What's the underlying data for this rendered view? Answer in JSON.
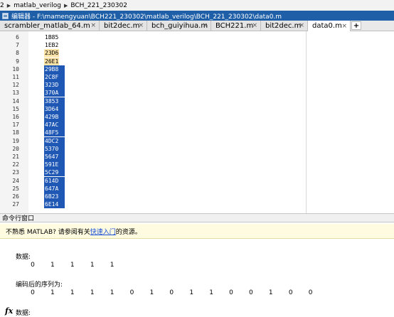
{
  "breadcrumb": {
    "pre": "2",
    "items": [
      "matlab_verilog",
      "BCH_221_230302"
    ]
  },
  "editor_title": "编辑器 - F:\\mamengyuan\\BCH221_230302\\matlab_verilog\\BCH_221_230302\\data0.m",
  "tabs": [
    {
      "label": "scrambler_matlab_64.m",
      "close": "×"
    },
    {
      "label": "bit2dec.m",
      "close": "×"
    },
    {
      "label": "bch_guiyihua.m",
      "close": "×"
    },
    {
      "label": "BCH221.m",
      "close": "×"
    },
    {
      "label": "bit2dec.m",
      "close": "×"
    },
    {
      "label": "data0.m",
      "close": "×",
      "active": true
    }
  ],
  "add_tab": "+",
  "code_lines": [
    {
      "n": "6",
      "t": "1B85",
      "s": "normal"
    },
    {
      "n": "7",
      "t": "1EB2",
      "s": "normal"
    },
    {
      "n": "8",
      "t": "23D6",
      "s": "hl"
    },
    {
      "n": "9",
      "t": "26E1",
      "s": "hl"
    },
    {
      "n": "10",
      "t": "29B8",
      "s": "sel"
    },
    {
      "n": "11",
      "t": "2C8F",
      "s": "sel"
    },
    {
      "n": "12",
      "t": "323D",
      "s": "sel"
    },
    {
      "n": "13",
      "t": "370A",
      "s": "sel"
    },
    {
      "n": "14",
      "t": "3853",
      "s": "sel"
    },
    {
      "n": "15",
      "t": "3D64",
      "s": "sel"
    },
    {
      "n": "16",
      "t": "429B",
      "s": "sel"
    },
    {
      "n": "17",
      "t": "47AC",
      "s": "sel"
    },
    {
      "n": "18",
      "t": "48F5",
      "s": "sel"
    },
    {
      "n": "19",
      "t": "4DC2",
      "s": "sel"
    },
    {
      "n": "20",
      "t": "5370",
      "s": "sel"
    },
    {
      "n": "21",
      "t": "5647",
      "s": "sel"
    },
    {
      "n": "22",
      "t": "591E",
      "s": "sel"
    },
    {
      "n": "23",
      "t": "5C29",
      "s": "sel"
    },
    {
      "n": "24",
      "t": "614D",
      "s": "sel"
    },
    {
      "n": "25",
      "t": "647A",
      "s": "sel"
    },
    {
      "n": "26",
      "t": "6B23",
      "s": "sel"
    },
    {
      "n": "27",
      "t": "6E14",
      "s": "sel"
    }
  ],
  "command_window": {
    "title": "命令行窗口",
    "notice_pre": "不熟悉 MATLAB? 请参阅有关",
    "notice_link": "快速入门",
    "notice_post": "的资源。",
    "label1": "数据:",
    "values1": [
      "0",
      "1",
      "1",
      "1",
      "1"
    ],
    "label2": "编码后的序列为:",
    "values2": [
      "0",
      "1",
      "1",
      "1",
      "1",
      "0",
      "1",
      "0",
      "1",
      "1",
      "0",
      "0",
      "1",
      "0",
      "0"
    ],
    "prompt_symbol": "fx",
    "prompt_text": "数据:"
  }
}
